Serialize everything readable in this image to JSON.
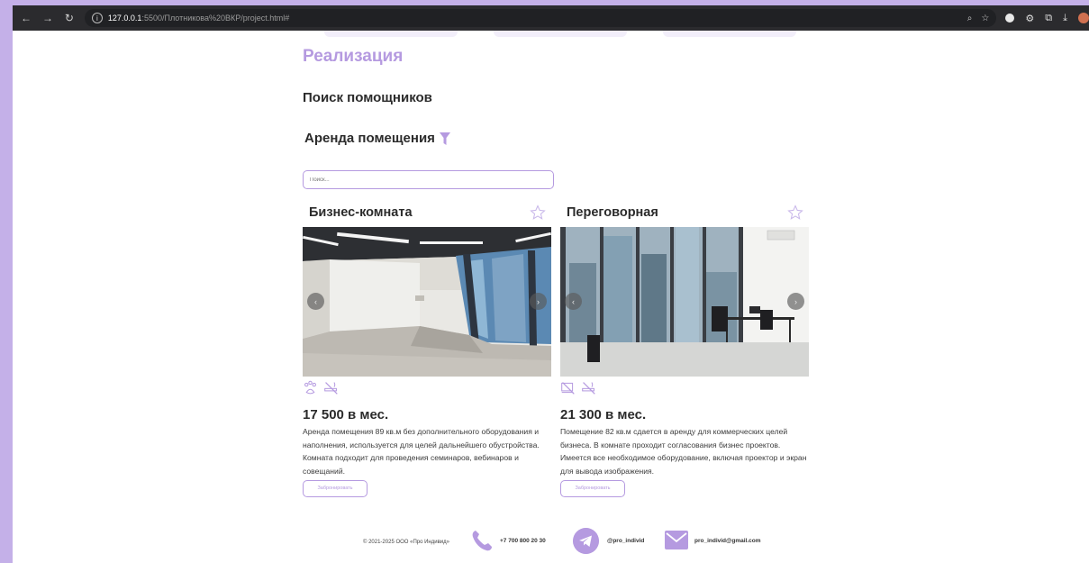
{
  "browser": {
    "url_host": "127.0.0.1",
    "url_path": ":5500/Плотникова%20ВКР/project.html#"
  },
  "page": {
    "section_title": "Реализация",
    "subtitle": "Поиск помощников",
    "rent_title": "Аренда помещения",
    "search_placeholder": "Поиск..."
  },
  "cards": [
    {
      "title": "Бизнес-комната",
      "price": "17 500 в мес.",
      "description": "Аренда помещения 89 кв.м без дополнительного оборудования и наполнения, используется для целей дальнейшего обустройства. Комната подходит для проведения семинаров, вебинаров и совещаний.",
      "button": "Забронировать",
      "features": [
        "pets-icon",
        "no-smoking-icon"
      ]
    },
    {
      "title": "Переговорная",
      "price": "21 300 в мес.",
      "description": "Помещение 82 кв.м сдается в аренду для коммерческих целей бизнеса. В комнате проходит согласования бизнес проектов. Имеется все необходимое оборудование, включая проектор и экран для вывода изображения.",
      "button": "Забронировать",
      "features": [
        "projector-icon",
        "no-smoking-icon"
      ]
    }
  ],
  "footer": {
    "copyright": "© 2021-2025 ООО «Про Индивид»",
    "phone": "+7 700 800 20 30",
    "telegram": "@pro_individ",
    "email": "pro_individ@gmail.com"
  },
  "colors": {
    "accent": "#b59ae0",
    "background": "#c4b0e8"
  }
}
